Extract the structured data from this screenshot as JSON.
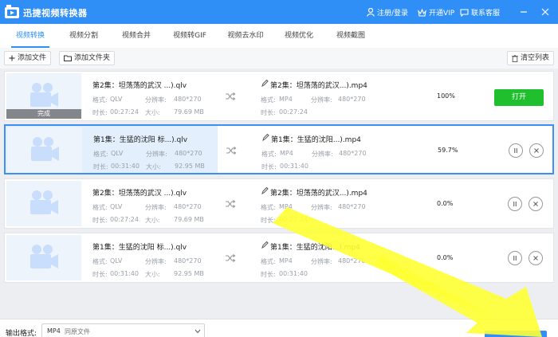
{
  "app": {
    "title": "迅捷视频转换器"
  },
  "titlebar": {
    "login": "注册/登录",
    "vip": "开通VIP",
    "service": "联系客服"
  },
  "tabs": [
    {
      "label": "视频转换",
      "active": true
    },
    {
      "label": "视频分割"
    },
    {
      "label": "视频合并"
    },
    {
      "label": "视频转GIF"
    },
    {
      "label": "视频去水印"
    },
    {
      "label": "视频优化"
    },
    {
      "label": "视频截图"
    }
  ],
  "toolbar": {
    "add_file": "添加文件",
    "add_folder": "添加文件夹",
    "clear_list": "清空列表"
  },
  "labels": {
    "format": "格式:",
    "resolution": "分辨率:",
    "duration": "时长:",
    "size": "大小:"
  },
  "files": [
    {
      "source": "第2集：坦荡荡的武汉 ...).qlv",
      "src_format": "QLV",
      "src_res": "480*270",
      "src_duration": "00:27:24",
      "src_size": "79.69 MB",
      "target": "第2集：坦荡荡的武汉...).mp4",
      "dst_format": "MP4",
      "dst_res": "480*270",
      "dst_duration": "00:27:24",
      "percent": "100%",
      "progress": 1.0,
      "thumb_status": "完成",
      "action": "打开"
    },
    {
      "source": "第1集：生猛的沈阳 标...).qlv",
      "src_format": "QLV",
      "src_res": "480*270",
      "src_duration": "00:31:40",
      "src_size": "92.95 MB",
      "target": "第1集：生猛的沈阳...).mp4",
      "dst_format": "MP4",
      "dst_res": "480*270",
      "dst_duration": "00:31:40",
      "percent": "59.7%",
      "progress": 0.597
    },
    {
      "source": "第2集：坦荡荡的武汉 ...).qlv",
      "src_format": "QLV",
      "src_res": "480*270",
      "src_duration": "00:27:24",
      "src_size": "79.69 MB",
      "target": "第2集：坦荡荡的武汉...).mp4",
      "dst_format": "MP4",
      "dst_res": "480*270",
      "dst_duration": "00:27:24",
      "percent": "0.0%",
      "progress": 0.0
    },
    {
      "source": "第1集：生猛的沈阳 标...).qlv",
      "src_format": "QLV",
      "src_res": "480*270",
      "src_duration": "00:31:40",
      "src_size": "92.95 MB",
      "target": "第1集：生猛的沈阳...).mp4",
      "dst_format": "MP4",
      "dst_res": "480*270",
      "dst_duration": "00:31:40",
      "percent": "0.0%",
      "progress": 0.0
    }
  ],
  "bottom": {
    "output_label": "输出格式:",
    "format": "MP4",
    "format_desc": "同原文件"
  },
  "colors": {
    "accent": "#2f8ff7",
    "success": "#1fbf2e",
    "arrow": "#ffff33"
  },
  "icons": [
    "app-logo-icon",
    "user-icon",
    "vip-crown-icon",
    "chat-icon",
    "minimize-icon",
    "close-icon",
    "plus-icon",
    "folder-icon",
    "trash-icon",
    "camera-icon",
    "shuffle-icon",
    "edit-icon",
    "pause-icon",
    "cancel-icon",
    "chevron-down-icon"
  ]
}
